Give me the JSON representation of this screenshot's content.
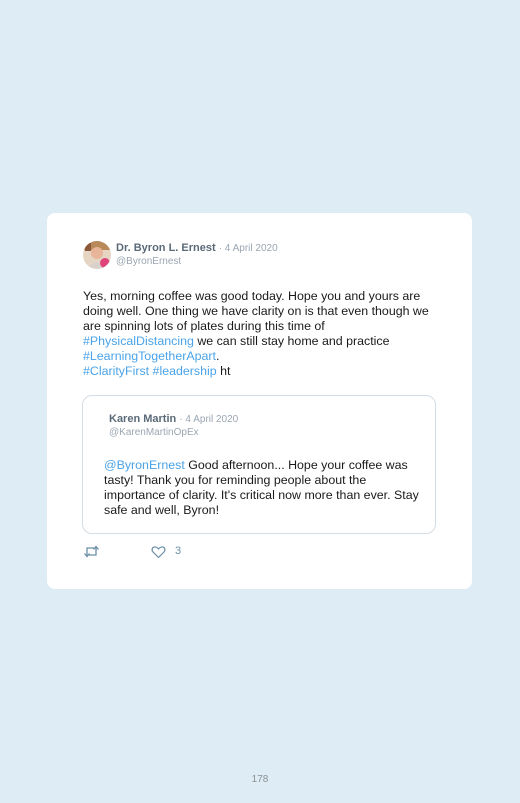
{
  "tweet": {
    "author_name": "Dr. Byron L. Ernest",
    "date": "· 4 April 2020",
    "handle": "@ByronErnest",
    "text_1": "Yes, morning coffee was good today. Hope you and yours are doing well. One thing we have clarity on is that even though we are spinning lots of plates during this time of ",
    "hashtag_1": "#PhysicalDistancing",
    "text_2": " we can still stay home and practice ",
    "hashtag_2": "#LearningTogetherApart",
    "text_3": ".",
    "hashtag_3": "#ClarityFirst",
    "hashtag_4": "#leadership",
    "text_4": " ht"
  },
  "quote": {
    "author_name": "Karen Martin",
    "date": "· 4 April 2020",
    "handle": "@KarenMartinOpEx",
    "mention": "@ByronErnest",
    "text": " Good afternoon... Hope your coffee was tasty! Thank you for reminding people about the importance of clarity. It's critical now more than ever. Stay safe and well, Byron!"
  },
  "actions": {
    "retweet_icon": "retweet-icon",
    "like_icon": "heart-icon",
    "like_count": "3"
  },
  "page_number": "178",
  "colors": {
    "background": "#deecf5",
    "link": "#4aa3e8"
  }
}
